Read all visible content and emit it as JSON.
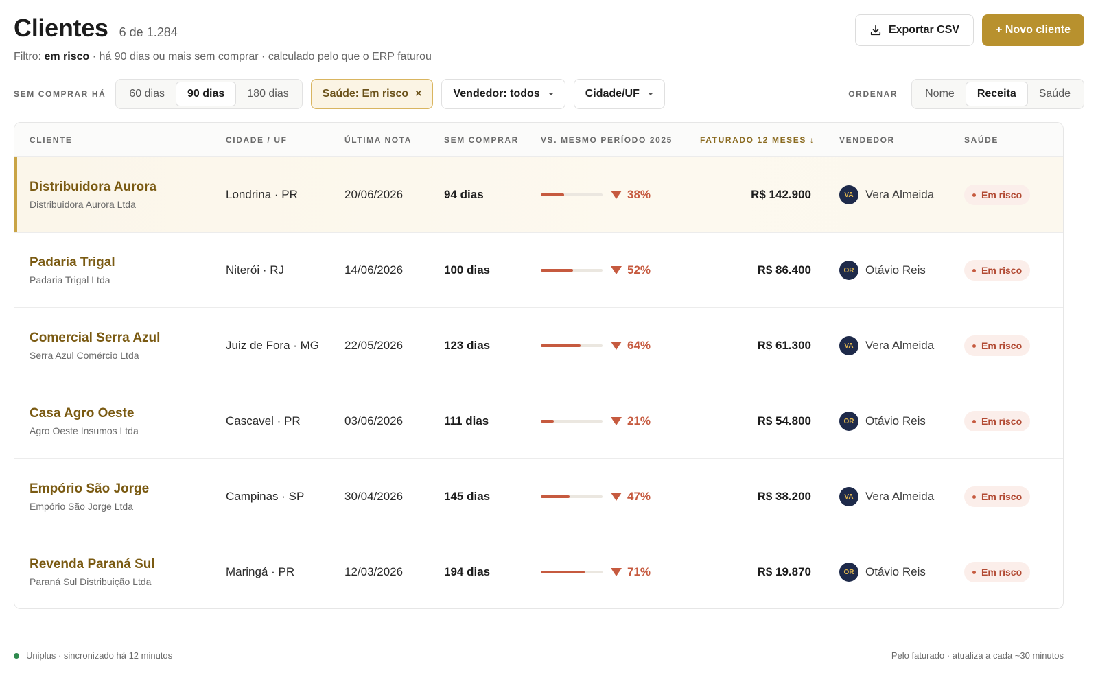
{
  "header": {
    "title": "Clientes",
    "count": "6 de 1.284",
    "subtitle_prefix": "Filtro:",
    "subtitle_filter": "em risco",
    "subtitle_rest": "· há 90 dias ou mais sem comprar · calculado pelo que o ERP faturou",
    "export_label": "Exportar CSV",
    "new_label": "+ Novo cliente"
  },
  "filters": {
    "period_label": "SEM COMPRAR HÁ",
    "period_options": [
      "60 dias",
      "90 dias",
      "180 dias"
    ],
    "period_selected": "90 dias",
    "health_chip": "Saúde: Em risco",
    "health_chip_close": "×",
    "seller_dropdown": "Vendedor: todos",
    "city_dropdown": "Cidade/UF",
    "sort_label": "ORDENAR",
    "sort_options": [
      "Nome",
      "Receita",
      "Saúde"
    ],
    "sort_selected": "Receita"
  },
  "table": {
    "headers": {
      "client": "CLIENTE",
      "city": "CIDADE / UF",
      "last_invoice": "ÚLTIMA NOTA",
      "no_purchase": "SEM COMPRAR",
      "vs_period": "VS. MESMO PERÍODO 2025",
      "revenue": "FATURADO 12 MESES ↓",
      "seller": "VENDEDOR",
      "health": "SAÚDE"
    },
    "rows": [
      {
        "name": "Distribuidora Aurora",
        "legal": "Distribuidora Aurora Ltda",
        "city": "Londrina · PR",
        "last_invoice": "20/06/2026",
        "days": "94 dias",
        "drop_pct": "38%",
        "drop_value": 0.38,
        "revenue": "R$ 142.900",
        "seller_initials": "VA",
        "seller": "Vera Almeida",
        "health": "Em risco"
      },
      {
        "name": "Padaria Trigal",
        "legal": "Padaria Trigal Ltda",
        "city": "Niterói · RJ",
        "last_invoice": "14/06/2026",
        "days": "100 dias",
        "drop_pct": "52%",
        "drop_value": 0.52,
        "revenue": "R$ 86.400",
        "seller_initials": "OR",
        "seller": "Otávio Reis",
        "health": "Em risco"
      },
      {
        "name": "Comercial Serra Azul",
        "legal": "Serra Azul Comércio Ltda",
        "city": "Juiz de Fora · MG",
        "last_invoice": "22/05/2026",
        "days": "123 dias",
        "drop_pct": "64%",
        "drop_value": 0.64,
        "revenue": "R$ 61.300",
        "seller_initials": "VA",
        "seller": "Vera Almeida",
        "health": "Em risco"
      },
      {
        "name": "Casa Agro Oeste",
        "legal": "Agro Oeste Insumos Ltda",
        "city": "Cascavel · PR",
        "last_invoice": "03/06/2026",
        "days": "111 dias",
        "drop_pct": "21%",
        "drop_value": 0.21,
        "revenue": "R$ 54.800",
        "seller_initials": "OR",
        "seller": "Otávio Reis",
        "health": "Em risco"
      },
      {
        "name": "Empório São Jorge",
        "legal": "Empório São Jorge Ltda",
        "city": "Campinas · SP",
        "last_invoice": "30/04/2026",
        "days": "145 dias",
        "drop_pct": "47%",
        "drop_value": 0.47,
        "revenue": "R$ 38.200",
        "seller_initials": "VA",
        "seller": "Vera Almeida",
        "health": "Em risco"
      },
      {
        "name": "Revenda Paraná Sul",
        "legal": "Paraná Sul Distribuição Ltda",
        "city": "Maringá · PR",
        "last_invoice": "12/03/2026",
        "days": "194 dias",
        "drop_pct": "71%",
        "drop_value": 0.71,
        "revenue": "R$ 19.870",
        "seller_initials": "OR",
        "seller": "Otávio Reis",
        "health": "Em risco"
      }
    ]
  },
  "footer": {
    "sync": "Uniplus · sincronizado há 12 minutos",
    "note": "Pelo faturado · atualiza a cada ~30 minutos"
  },
  "colors": {
    "accent": "#b8912e",
    "danger": "#c65a3f",
    "avatar_bg": "#1e2a4a",
    "sync_ok": "#2f8a4e"
  }
}
